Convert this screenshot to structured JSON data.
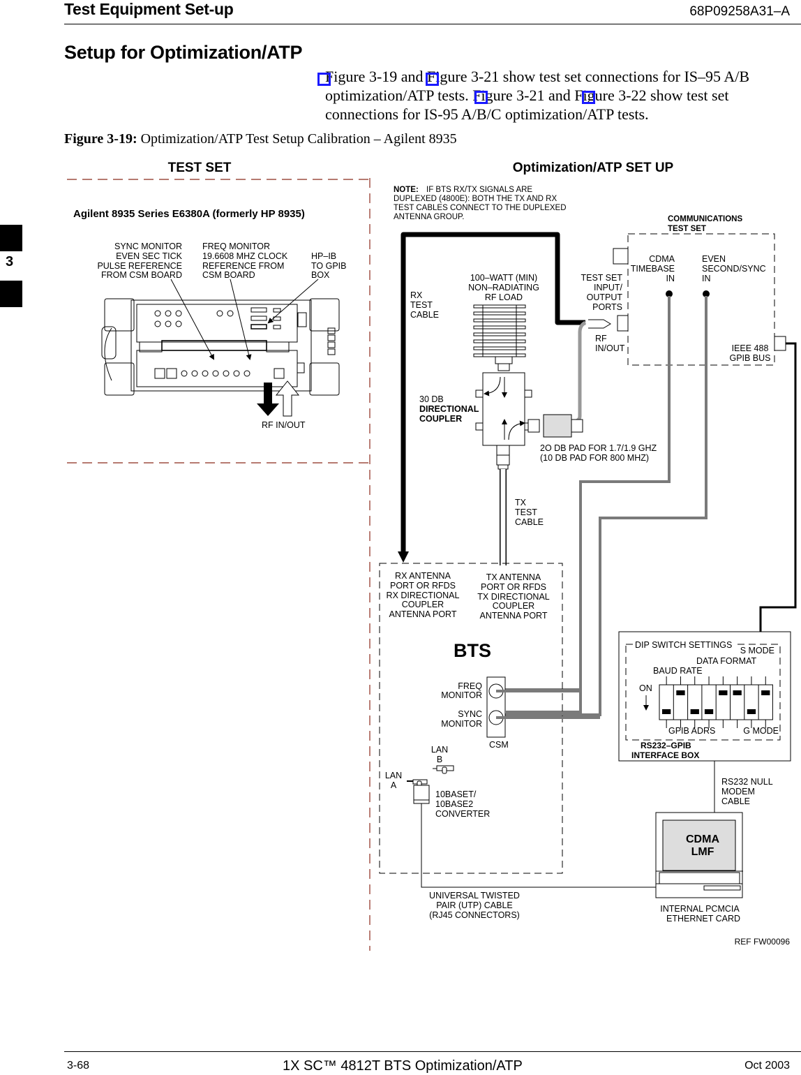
{
  "header": {
    "section": "Test Equipment Set-up",
    "doc_number": "68P09258A31–A"
  },
  "section_title": "Setup for Optimization/ATP",
  "body": {
    "lines": [
      "Figure 3-19 and Figure 3-21 show test set connections for IS–95 A/B",
      "optimization/ATP tests. Figure 3-21 and Figure 3-22 show test set",
      "connections for IS-95 A/B/C optimization/ATP tests."
    ]
  },
  "figure": {
    "number": "Figure 3-19:",
    "caption": "Optimization/ATP Test Setup Calibration – Agilent 8935",
    "ref": "REF FW00096",
    "panels": {
      "left": "TEST SET",
      "right": "Optimization/ATP SET UP"
    },
    "test_set": {
      "model": "Agilent 8935 Series E6380A (formerly HP 8935)",
      "sync_monitor": [
        "SYNC MONITOR",
        "EVEN SEC TICK",
        "PULSE REFERENCE",
        "FROM CSM BOARD"
      ],
      "freq_monitor": [
        "FREQ MONITOR",
        "19.6608 MHZ CLOCK",
        "REFERENCE FROM",
        "CSM BOARD"
      ],
      "hpib": [
        "HP–IB",
        "TO GPIB",
        "BOX"
      ],
      "rf_in_out": "RF IN/OUT"
    },
    "note": {
      "label": "NOTE:",
      "lines": [
        "IF BTS RX/TX SIGNALS ARE",
        "DUPLEXED (4800E): BOTH THE TX AND RX",
        "TEST CABLES CONNECT TO THE DUPLEXED",
        "ANTENNA GROUP."
      ]
    },
    "comm_test_set": {
      "title": [
        "COMMUNICATIONS",
        "TEST SET"
      ],
      "cdma_timebase": [
        "CDMA",
        "TIMEBASE",
        "IN"
      ],
      "even_second": [
        "EVEN",
        "SECOND/SYNC",
        "IN"
      ],
      "io_ports": [
        "TEST SET",
        "INPUT/",
        "OUTPUT",
        "PORTS"
      ],
      "rf_in_out": [
        "RF",
        "IN/OUT"
      ],
      "gpib_bus": [
        "IEEE 488",
        "GPIB BUS"
      ]
    },
    "rx_test_cable": [
      "RX",
      "TEST",
      "CABLE"
    ],
    "tx_test_cable": [
      "TX",
      "TEST",
      "CABLE"
    ],
    "rf_load": [
      "100–WATT (MIN)",
      "NON–RADIATING",
      "RF LOAD"
    ],
    "coupler": {
      "value": "30 DB",
      "name": [
        "DIRECTIONAL",
        "COUPLER"
      ]
    },
    "pad": [
      "2O DB PAD FOR 1.7/1.9 GHZ",
      "(10 DB PAD FOR 800 MHZ)"
    ],
    "bts": {
      "title": "BTS",
      "rx_port": [
        "RX ANTENNA",
        "PORT OR RFDS",
        "RX DIRECTIONAL",
        "COUPLER",
        "ANTENNA PORT"
      ],
      "tx_port": [
        "TX ANTENNA",
        "PORT OR RFDS",
        "TX DIRECTIONAL",
        "COUPLER",
        "ANTENNA PORT"
      ],
      "freq_monitor": [
        "FREQ",
        "MONITOR"
      ],
      "sync_monitor": [
        "SYNC",
        "MONITOR"
      ],
      "csm": "CSM",
      "lan_b": [
        "LAN",
        "B"
      ],
      "lan_a": [
        "LAN",
        "A"
      ],
      "converter": [
        "10BASET/",
        "10BASE2",
        "CONVERTER"
      ]
    },
    "interface_box": {
      "title": [
        "RS232–GPIB",
        "INTERFACE BOX"
      ],
      "dip_title": "DIP SWITCH SETTINGS",
      "s_mode": "S MODE",
      "data_format": "DATA FORMAT",
      "baud_rate": "BAUD RATE",
      "on": "ON",
      "gpib_adrs": "GPIB ADRS",
      "g_mode": "G MODE",
      "switches_on": [
        true,
        false,
        true,
        true,
        false,
        false,
        true,
        false
      ]
    },
    "null_modem": [
      "RS232 NULL",
      "MODEM",
      "CABLE"
    ],
    "lmf": {
      "screen": [
        "CDMA",
        "LMF"
      ],
      "card": [
        "INTERNAL PCMCIA",
        "ETHERNET CARD"
      ]
    },
    "utp": [
      "UNIVERSAL TWISTED",
      "PAIR (UTP) CABLE",
      "(RJ45 CONNECTORS)"
    ]
  },
  "side_tab": {
    "chapter": "3"
  },
  "footer": {
    "page": "3-68",
    "title": "1X SC™ 4812T BTS Optimization/ATP",
    "date": "Oct 2003"
  }
}
